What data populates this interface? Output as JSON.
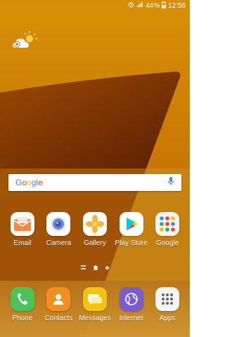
{
  "status": {
    "battery_text": "44%",
    "time": "12:56"
  },
  "search": {
    "logo_letters": [
      "G",
      "o",
      "o",
      "g",
      "l",
      "e"
    ]
  },
  "home_apps": [
    {
      "label": "Email",
      "icon": "email-icon"
    },
    {
      "label": "Camera",
      "icon": "camera-icon"
    },
    {
      "label": "Gallery",
      "icon": "gallery-icon"
    },
    {
      "label": "Play Store",
      "icon": "play-store-icon"
    },
    {
      "label": "Google",
      "icon": "google-folder-icon"
    }
  ],
  "dock_apps": [
    {
      "label": "Phone",
      "icon": "phone-icon"
    },
    {
      "label": "Contacts",
      "icon": "contacts-icon"
    },
    {
      "label": "Messages",
      "icon": "messages-icon"
    },
    {
      "label": "Internet",
      "icon": "internet-icon"
    },
    {
      "label": "Apps",
      "icon": "apps-grid-icon"
    }
  ],
  "colors": {
    "email": "#f08a4b",
    "camera": "#6d86d8",
    "gallery": "#f2b534",
    "phone": "#4cc25c",
    "contacts": "#f0901e",
    "messages": "#f5c20f",
    "internet": "#7b5ccf"
  }
}
